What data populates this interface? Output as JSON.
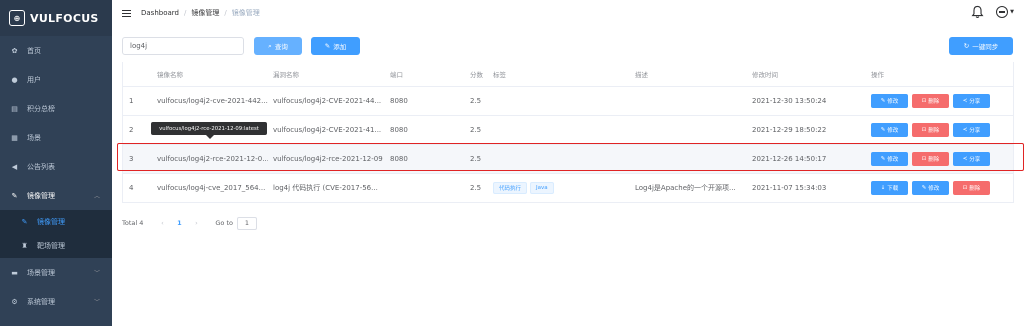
{
  "app": {
    "logo_text": "VULFOCUS"
  },
  "sidebar": {
    "items": [
      {
        "label": "首页",
        "icon": "dashboard-icon"
      },
      {
        "label": "用户",
        "icon": "user-icon"
      },
      {
        "label": "积分总榜",
        "icon": "ranking-icon"
      },
      {
        "label": "场景",
        "icon": "scene-icon"
      },
      {
        "label": "公告列表",
        "icon": "announcement-icon"
      },
      {
        "label": "镜像管理",
        "icon": "image-manage-icon",
        "open": true
      },
      {
        "label": "镜像管理",
        "icon": "image-icon",
        "active": true,
        "sub": true
      },
      {
        "label": "靶场管理",
        "icon": "target-icon",
        "sub": true
      },
      {
        "label": "场景管理",
        "icon": "scene-manage-icon"
      },
      {
        "label": "系统管理",
        "icon": "settings-icon"
      }
    ]
  },
  "header": {
    "breadcrumb": [
      "Dashboard",
      "镜像管理",
      "镜像管理"
    ]
  },
  "toolbar": {
    "search_value": "log4j",
    "query_label": "查询",
    "add_label": "添加",
    "sync_label": "一键同步"
  },
  "table": {
    "columns": [
      "镜像名称",
      "漏洞名称",
      "端口",
      "分数",
      "标签",
      "描述",
      "修改时间",
      "操作"
    ],
    "rows": [
      {
        "index": "1",
        "image_name": "vulfocus/log4j2-cve-2021-442...",
        "vul_name": "vulfocus/log4j2-CVE-2021-44...",
        "port": "8080",
        "score": "2.5",
        "tags": [],
        "description": "",
        "modified": "2021-12-30 13:50:24",
        "actions": [
          "修改",
          "删除",
          "分享"
        ]
      },
      {
        "index": "2",
        "image_name": "vulfocus/log4j2-rce-2021-12-09:latest",
        "vul_name": "vulfocus/log4j2-CVE-2021-41...",
        "port": "8080",
        "score": "2.5",
        "tags": [],
        "description": "",
        "modified": "2021-12-29 18:50:22",
        "actions": [
          "修改",
          "删除",
          "分享"
        ]
      },
      {
        "index": "3",
        "image_name": "vulfocus/log4j2-rce-2021-12-0...",
        "vul_name": "vulfocus/log4j2-rce-2021-12-09",
        "port": "8080",
        "score": "2.5",
        "tags": [],
        "description": "",
        "modified": "2021-12-26 14:50:17",
        "actions": [
          "修改",
          "删除",
          "分享"
        ]
      },
      {
        "index": "4",
        "image_name": "vulfocus/log4j-cve_2017_564...",
        "vul_name": "log4j 代码执行 (CVE-2017-56...",
        "port": "",
        "score": "2.5",
        "tags": [
          "代码执行",
          "Java"
        ],
        "description": "Log4j是Apache的一个开源项...",
        "modified": "2021-11-07 15:34:03",
        "actions": [
          "下载",
          "修改",
          "删除"
        ]
      }
    ]
  },
  "tooltip": {
    "text": "vulfocus/log4j2-rce-2021-12-09:latest"
  },
  "pagination": {
    "total_label": "Total 4",
    "current_page": "1",
    "goto_label": "Go to",
    "goto_value": "1"
  },
  "colors": {
    "sidebar_bg": "#304156",
    "primary": "#409eff",
    "danger": "#f56c6c",
    "highlight": "#e02424"
  }
}
